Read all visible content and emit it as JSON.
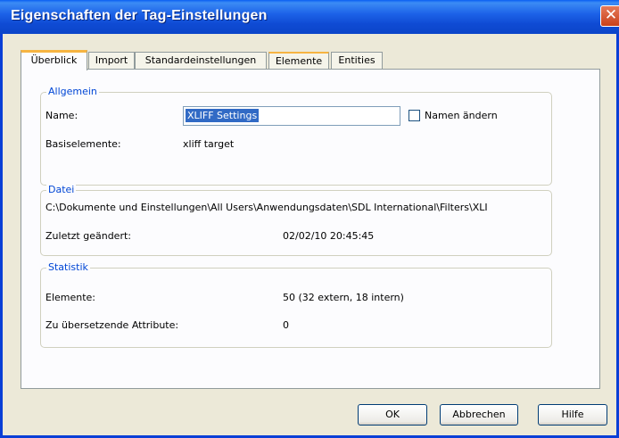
{
  "window": {
    "title": "Eigenschaften der Tag-Einstellungen"
  },
  "tabs": [
    "Überblick",
    "Import",
    "Standardeinstellungen",
    "Elemente",
    "Entities"
  ],
  "active_tab": "Überblick",
  "general": {
    "legend": "Allgemein",
    "name_label": "Name:",
    "name_value": "XLIFF Settings",
    "rename_label": "Namen ändern",
    "rename_checked": false,
    "base_label": "Basiselemente:",
    "base_value": "xliff target"
  },
  "file": {
    "legend": "Datei",
    "path": "C:\\Dokumente und Einstellungen\\All Users\\Anwendungsdaten\\SDL International\\Filters\\XLI",
    "modified_label": "Zuletzt geändert:",
    "modified_value": "02/02/10 20:45:45"
  },
  "stats": {
    "legend": "Statistik",
    "elements_label": "Elemente:",
    "elements_value": "50 (32 extern, 18 intern)",
    "attrs_label": "Zu übersetzende Attribute:",
    "attrs_value": "0"
  },
  "buttons": {
    "ok": "OK",
    "cancel": "Abbrechen",
    "help": "Hilfe"
  }
}
